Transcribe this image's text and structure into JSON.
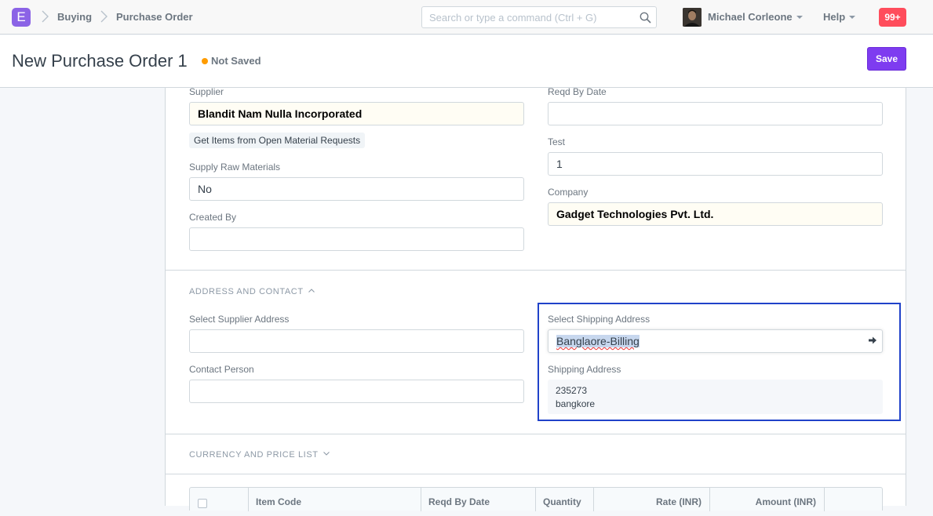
{
  "navbar": {
    "logo_letter": "E",
    "breadcrumbs": [
      "Buying",
      "Purchase Order"
    ],
    "search_placeholder": "Search or type a command (Ctrl + G)",
    "user_name": "Michael Corleone",
    "help_label": "Help",
    "notification_count": "99+"
  },
  "page": {
    "title": "New Purchase Order 1",
    "status": "Not Saved",
    "save_label": "Save"
  },
  "details": {
    "supplier_label": "Supplier",
    "supplier_value": "Blandit Nam Nulla Incorporated",
    "get_items_label": "Get Items from Open Material Requests",
    "supply_raw_label": "Supply Raw Materials",
    "supply_raw_value": "No",
    "created_by_label": "Created By",
    "created_by_value": "",
    "reqd_by_label": "Reqd By Date",
    "reqd_by_value": "",
    "test_label": "Test",
    "test_value": "1",
    "company_label": "Company",
    "company_value": "Gadget Technologies Pvt. Ltd."
  },
  "address_section": {
    "heading": "ADDRESS AND CONTACT",
    "supplier_address_label": "Select Supplier Address",
    "supplier_address_value": "",
    "contact_person_label": "Contact Person",
    "contact_person_value": "",
    "shipping_address_select_label": "Select Shipping Address",
    "shipping_address_select_value": "Banglaore-Billing",
    "shipping_address_label": "Shipping Address",
    "shipping_address_lines": [
      "235273",
      "bangkore"
    ]
  },
  "currency_section": {
    "heading": "CURRENCY AND PRICE LIST"
  },
  "items_table": {
    "columns": [
      "Item Code",
      "Reqd By Date",
      "Quantity",
      "Rate (INR)",
      "Amount (INR)"
    ]
  },
  "colors": {
    "accent": "#7e3cf0",
    "logo": "#8b63e6",
    "highlight_border": "#2042c9",
    "status_dot": "#ff9c00",
    "notification": "#ff4d5c"
  }
}
